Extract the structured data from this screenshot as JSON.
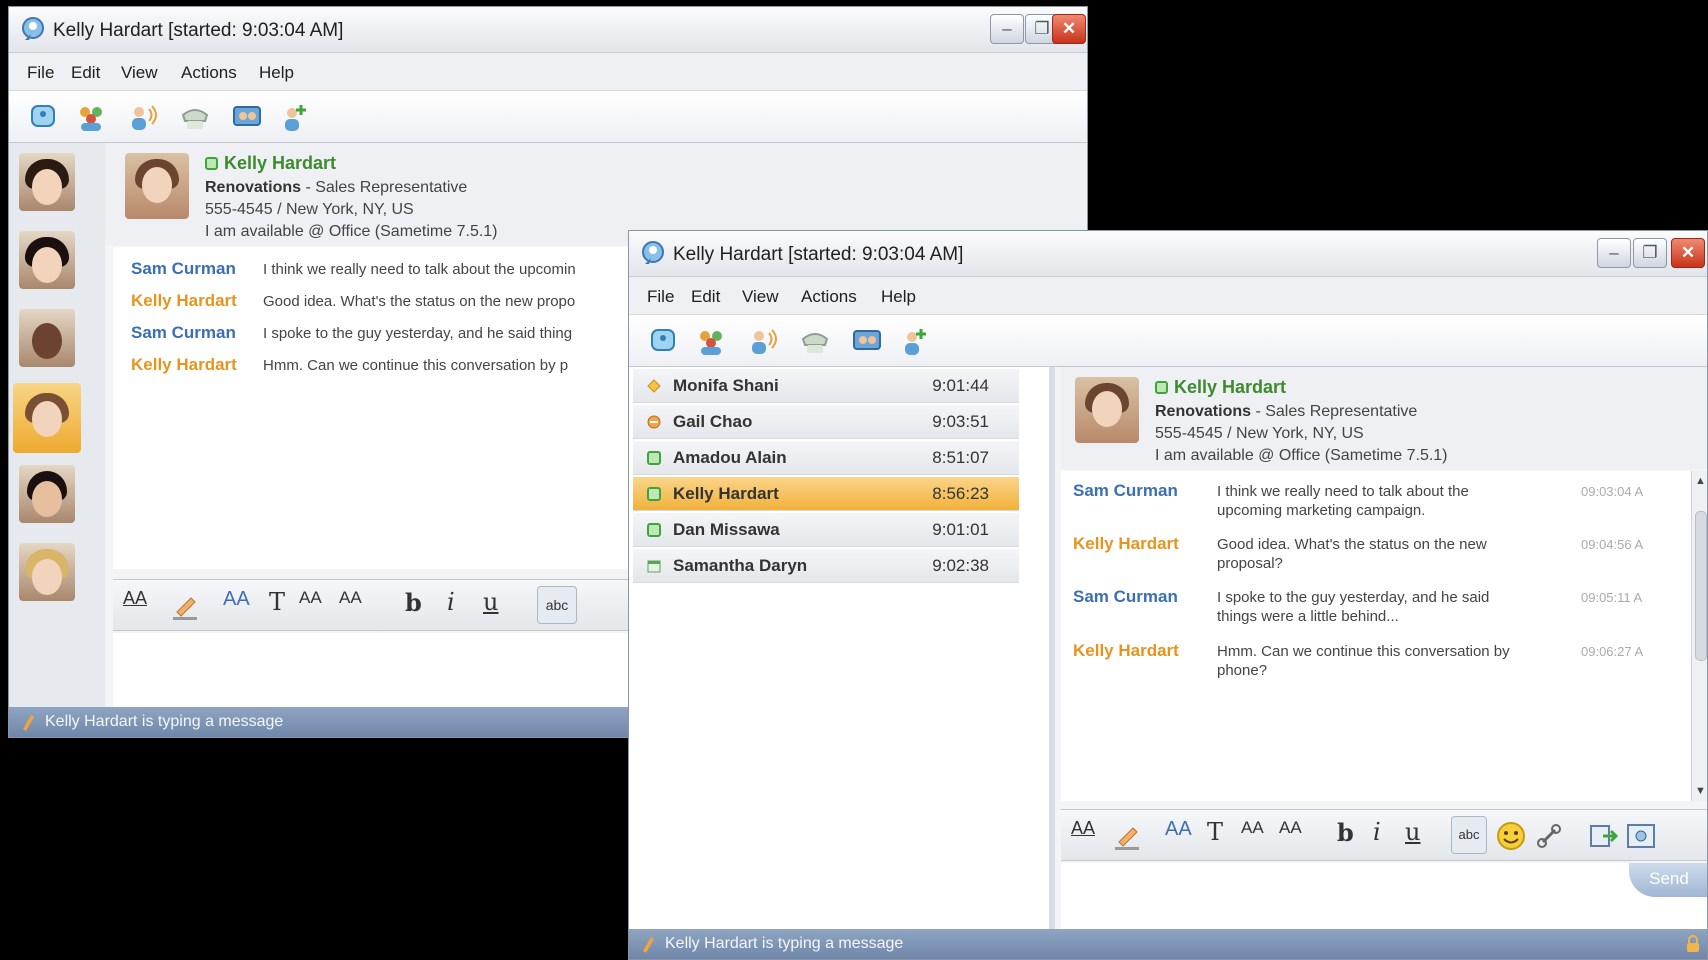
{
  "back_window": {
    "title": "Kelly Hardart [started: 9:03:04 AM]",
    "menu": [
      "File",
      "Edit",
      "View",
      "Actions",
      "Help"
    ],
    "profile": {
      "name": "Kelly Hardart",
      "company": "Renovations",
      "role": " - Sales Representative",
      "phone_location": "555-4545 / New York, NY, US",
      "status": "I am available @ Office (Sametime 7.5.1)"
    },
    "messages": [
      {
        "sender": "Sam Curman",
        "text": "I think we really need to talk about the upcomin"
      },
      {
        "sender": "Kelly Hardart",
        "text": "Good idea. What's the status on the new propo"
      },
      {
        "sender": "Sam Curman",
        "text": "I spoke to the guy yesterday, and he said thing"
      },
      {
        "sender": "Kelly Hardart",
        "text": "Hmm. Can we continue this conversation by p"
      }
    ],
    "status_bar": "Kelly Hardart is typing a message"
  },
  "front_window": {
    "title": "Kelly Hardart [started: 9:03:04 AM]",
    "menu": [
      "File",
      "Edit",
      "View",
      "Actions",
      "Help"
    ],
    "contacts": [
      {
        "name": "Monifa Shani",
        "time": "9:01:44",
        "status": "away"
      },
      {
        "name": "Gail Chao",
        "time": "9:03:51",
        "status": "in-meeting"
      },
      {
        "name": "Amadou Alain",
        "time": "8:51:07",
        "status": "available"
      },
      {
        "name": "Kelly Hardart",
        "time": "8:56:23",
        "status": "available",
        "selected": true
      },
      {
        "name": "Dan Missawa",
        "time": "9:01:01",
        "status": "available"
      },
      {
        "name": "Samantha Daryn",
        "time": "9:02:38",
        "status": "calendar"
      }
    ],
    "profile": {
      "name": "Kelly Hardart",
      "company": "Renovations",
      "role": " - Sales Representative",
      "phone_location": "555-4545 / New York, NY, US",
      "status": "I am available @ Office (Sametime 7.5.1)"
    },
    "messages": [
      {
        "sender": "Sam Curman",
        "text": "I think we really need to talk about the upcoming marketing campaign.",
        "time": "09:03:04 A"
      },
      {
        "sender": "Kelly Hardart",
        "text": "Good idea. What's the status on the new proposal?",
        "time": "09:04:56 A"
      },
      {
        "sender": "Sam Curman",
        "text": "I spoke to the guy yesterday, and he said things were a little behind...",
        "time": "09:05:11 A"
      },
      {
        "sender": "Kelly Hardart",
        "text": "Hmm. Can we continue this conversation by phone?",
        "time": "09:06:27 A"
      }
    ],
    "send_label": "Send",
    "status_bar": "Kelly Hardart is typing a message"
  },
  "format_glyphs": {
    "font": "AA",
    "bold": "b",
    "italic": "i",
    "underline": "u",
    "text": "T",
    "grow": "AA",
    "shrink": "AA",
    "spell": "abc"
  },
  "colors": {
    "sam": "#3b6fb5",
    "kelly": "#e7941e",
    "available": "#3ea53a",
    "selected_row": "#f1b13a"
  }
}
